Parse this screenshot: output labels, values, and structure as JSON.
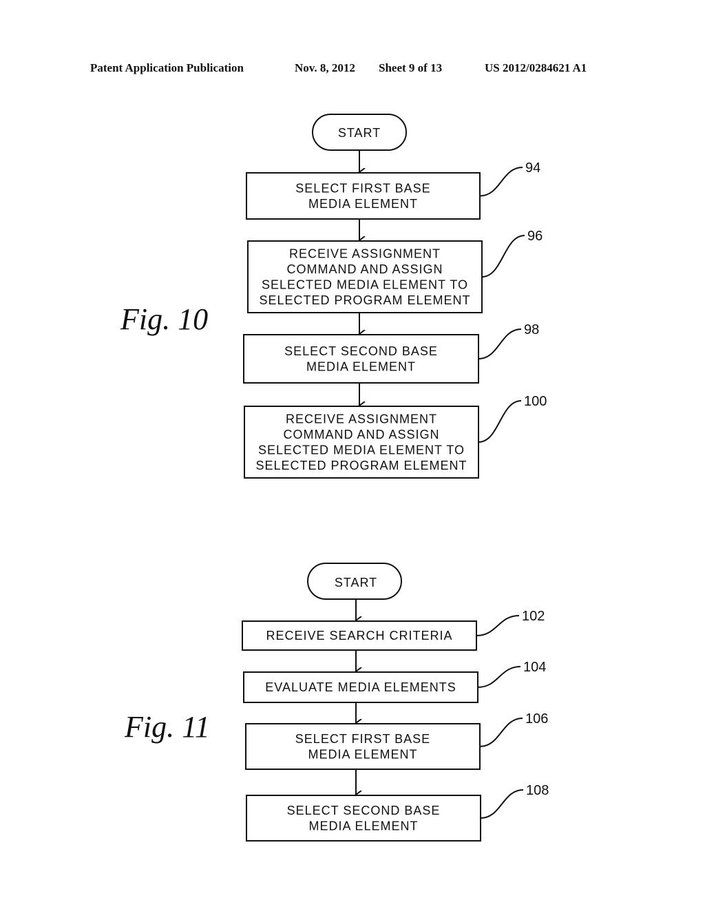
{
  "header": {
    "left": "Patent Application Publication",
    "date": "Nov. 8, 2012",
    "sheet": "Sheet 9 of 13",
    "number": "US 2012/0284621 A1"
  },
  "fig10": {
    "label": "Fig. 10",
    "start": "START",
    "steps": [
      {
        "ref": "94",
        "lines": [
          "SELECT FIRST BASE",
          "MEDIA ELEMENT"
        ]
      },
      {
        "ref": "96",
        "lines": [
          "RECEIVE ASSIGNMENT",
          "COMMAND AND ASSIGN",
          "SELECTED MEDIA ELEMENT TO",
          "SELECTED PROGRAM ELEMENT"
        ]
      },
      {
        "ref": "98",
        "lines": [
          "SELECT SECOND BASE",
          "MEDIA ELEMENT"
        ]
      },
      {
        "ref": "100",
        "lines": [
          "RECEIVE ASSIGNMENT",
          "COMMAND AND ASSIGN",
          "SELECTED MEDIA ELEMENT TO",
          "SELECTED PROGRAM ELEMENT"
        ]
      }
    ]
  },
  "fig11": {
    "label": "Fig. 11",
    "start": "START",
    "steps": [
      {
        "ref": "102",
        "lines": [
          "RECEIVE SEARCH CRITERIA"
        ]
      },
      {
        "ref": "104",
        "lines": [
          "EVALUATE MEDIA ELEMENTS"
        ]
      },
      {
        "ref": "106",
        "lines": [
          "SELECT FIRST BASE",
          "MEDIA ELEMENT"
        ]
      },
      {
        "ref": "108",
        "lines": [
          "SELECT SECOND BASE",
          "MEDIA ELEMENT"
        ]
      }
    ]
  }
}
